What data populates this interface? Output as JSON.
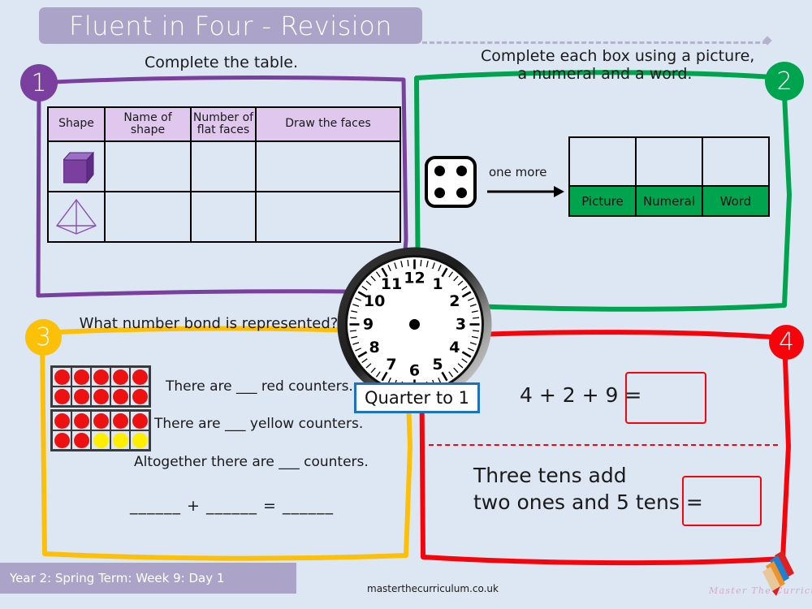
{
  "header": {
    "title": "Fluent in Four - Revision",
    "banner_color": "#aba4c8"
  },
  "sections": [
    {
      "number": "1",
      "color": "#7b3fa0",
      "prompt": "Complete the table.",
      "table": {
        "headers": [
          "Shape",
          "Name of shape",
          "Number of flat faces",
          "Draw the faces"
        ],
        "rows": [
          {
            "shape_icon": "cube-3d-icon",
            "name": "",
            "faces": "",
            "draw": ""
          },
          {
            "shape_icon": "square-pyramid-icon",
            "name": "",
            "faces": "",
            "draw": ""
          }
        ]
      }
    },
    {
      "number": "2",
      "color": "#00a44f",
      "prompt_line1": "Complete each box using a picture,",
      "prompt_line2": "a numeral and a word.",
      "dice_value": "4",
      "arrow_label": "one more",
      "table": {
        "blank_row": [
          "",
          "",
          ""
        ],
        "label_row": [
          "Picture",
          "Numeral",
          "Word"
        ],
        "label_bg": "#00a44f"
      }
    },
    {
      "number": "3",
      "color": "#fdc009",
      "prompt": "What number bond is represented?",
      "ten_frames": [
        {
          "counters": [
            "red",
            "red",
            "red",
            "red",
            "red",
            "red",
            "red",
            "red",
            "red",
            "red"
          ]
        },
        {
          "counters": [
            "red",
            "red",
            "red",
            "red",
            "red",
            "red",
            "red",
            "yellow",
            "yellow",
            "yellow"
          ]
        }
      ],
      "lines": [
        "There are ___ red counters.",
        "There are ___ yellow counters.",
        "Altogether there are ___  counters.",
        "______ + ______ = ______"
      ]
    },
    {
      "number": "4",
      "color": "#f5050b",
      "question1": "4 + 2 + 9 =",
      "question2_line1": "Three tens add",
      "question2_line2": "two ones and 5 tens ="
    }
  ],
  "clock": {
    "numerals": [
      "1",
      "2",
      "3",
      "4",
      "5",
      "6",
      "7",
      "8",
      "9",
      "10",
      "11",
      "12"
    ],
    "label": "Quarter to 1",
    "label_border_color": "#1a72c0"
  },
  "footer": {
    "lesson": "Year 2: Spring Term: Week  9: Day 1",
    "website": "masterthecurriculum.co.uk",
    "logo_text": "Master  The  Curriculum",
    "logo_icon": "pencil-logo-icon"
  }
}
